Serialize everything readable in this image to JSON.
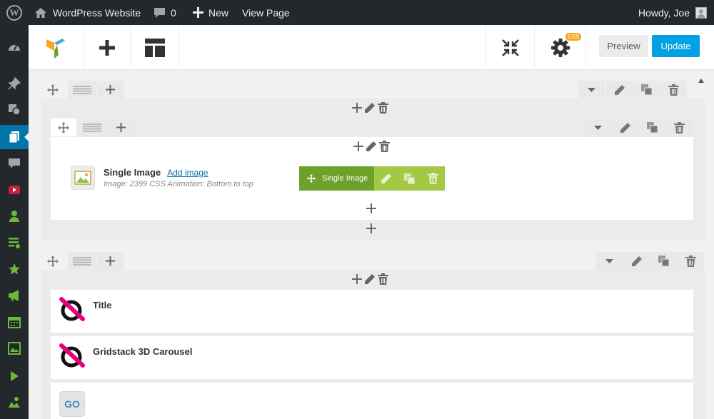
{
  "admin_bar": {
    "site_name": "WordPress Website",
    "comments_count": "0",
    "new_label": "New",
    "view_page_label": "View Page",
    "howdy": "Howdy, Joe"
  },
  "sidebar": {
    "items": [
      {
        "icon": "dashboard-icon"
      },
      {
        "icon": "pin-icon"
      },
      {
        "icon": "media-icon"
      },
      {
        "icon": "pages-icon",
        "active": true
      },
      {
        "icon": "comments-icon"
      },
      {
        "icon": "youtube-icon"
      },
      {
        "icon": "users-icon"
      },
      {
        "icon": "playlist-icon"
      },
      {
        "icon": "star-icon"
      },
      {
        "icon": "megaphone-icon"
      },
      {
        "icon": "calendar-icon"
      },
      {
        "icon": "gallery-icon"
      },
      {
        "icon": "play-icon"
      },
      {
        "icon": "map-icon"
      }
    ]
  },
  "toolbar": {
    "css_badge": "CSS",
    "preview_label": "Preview",
    "update_label": "Update"
  },
  "single_image": {
    "title": "Single Image",
    "add_link": "Add image",
    "meta": "Image: 2399  CSS Animation: Bottom to top",
    "hover_label": "Single Image"
  },
  "elements": [
    {
      "title": "Title"
    },
    {
      "title": "Gridstack 3D Carousel"
    },
    {
      "title": "",
      "icon_text": "GO"
    }
  ],
  "colors": {
    "admin_bar": "#23282d",
    "active_menu": "#0073aa",
    "update_button": "#00a0e4",
    "element_controls_dark": "#6ea12a",
    "element_controls_light": "#a3c844",
    "css_badge": "#f5a623"
  }
}
